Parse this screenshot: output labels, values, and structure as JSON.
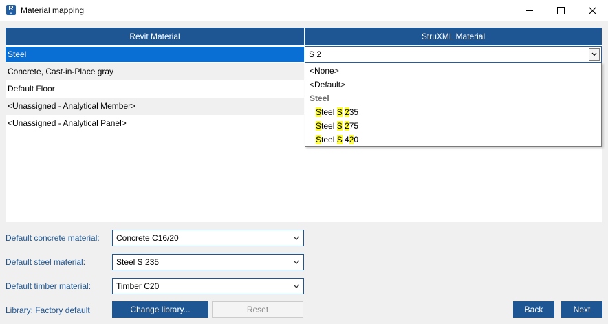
{
  "window": {
    "title": "Material mapping",
    "app_icon_letter": "R"
  },
  "table": {
    "headers": [
      "Revit Material",
      "StruXML Material"
    ],
    "rows": [
      "Steel",
      "Concrete, Cast-in-Place gray",
      "Default Floor",
      "<Unassigned - Analytical Member>",
      "<Unassigned - Analytical Panel>"
    ],
    "selected_row": 0
  },
  "combo": {
    "value": "S 2"
  },
  "dropdown": {
    "items": [
      "<None>",
      "<Default>"
    ],
    "group": "Steel",
    "options": [
      {
        "full": "Steel S 235",
        "parts": [
          "S",
          "teel ",
          "S",
          " ",
          "2",
          "35"
        ]
      },
      {
        "full": "Steel S 275",
        "parts": [
          "S",
          "teel ",
          "S",
          " ",
          "2",
          "75"
        ]
      },
      {
        "full": "Steel S 420",
        "parts": [
          "S",
          "teel ",
          "S",
          " 4",
          "2",
          "0"
        ]
      }
    ]
  },
  "defaults": {
    "concrete_label": "Default concrete material:",
    "concrete_value": "Concrete C16/20",
    "steel_label": "Default steel material:",
    "steel_value": "Steel S 235",
    "timber_label": "Default timber material:",
    "timber_value": "Timber C20"
  },
  "footer": {
    "library_label": "Library: Factory default",
    "change_library": "Change library...",
    "reset": "Reset",
    "back": "Back",
    "next": "Next"
  },
  "colors": {
    "accent": "#1e5694",
    "selection": "#0a6fd4",
    "highlight": "#ffff33"
  }
}
